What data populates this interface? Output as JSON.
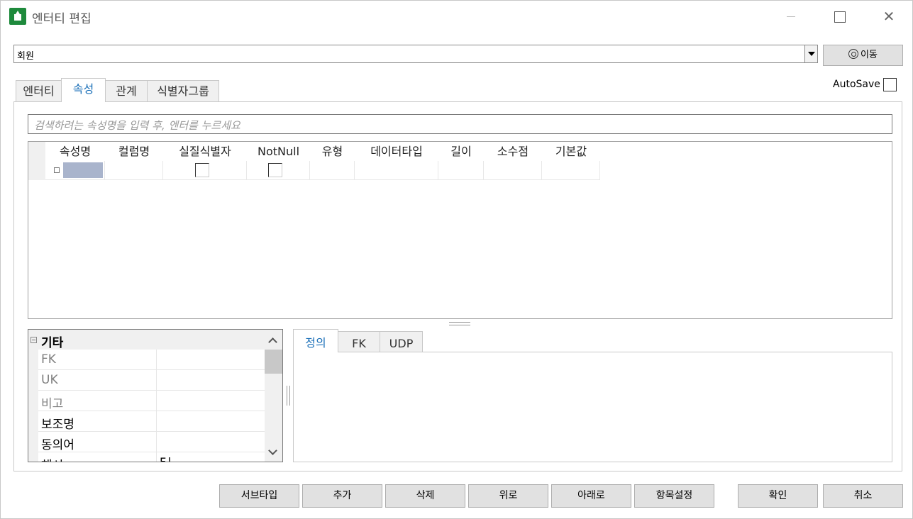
{
  "window": {
    "title": "엔터티 편집",
    "controls": {
      "minimize": "—",
      "maximize": "□",
      "close": "✕"
    }
  },
  "entity_selector": {
    "value": "회원"
  },
  "move_button": {
    "label": "이동",
    "icon": "target-icon"
  },
  "tabs": [
    {
      "label": "엔터티",
      "active": false
    },
    {
      "label": "속성",
      "active": true
    },
    {
      "label": "관계",
      "active": false
    },
    {
      "label": "식별자그룹",
      "active": false
    }
  ],
  "autosave": {
    "label": "AutoSave",
    "checked": false
  },
  "search": {
    "placeholder": "검색하려는 속성명을 입력 후, 엔터를 누르세요",
    "value": ""
  },
  "attribute_grid": {
    "columns": [
      "속성명",
      "컬럼명",
      "실질식별자",
      "NotNull",
      "유형",
      "데이터타입",
      "길이",
      "소수점",
      "기본값"
    ],
    "rows": [
      {
        "name": "",
        "column": "",
        "real_identifier": false,
        "not_null": false,
        "type": "",
        "data_type": "",
        "length": "",
        "decimal": "",
        "default": ""
      }
    ]
  },
  "properties": {
    "category": "기타",
    "collapse_glyph": "⊟",
    "rows": [
      {
        "name": "FK",
        "value": "",
        "greyed": true
      },
      {
        "name": "UK",
        "value": "",
        "greyed": true
      },
      {
        "name": "비고",
        "value": "",
        "greyed": true
      },
      {
        "name": "보조명",
        "value": "",
        "greyed": false
      },
      {
        "name": "동의어",
        "value": "",
        "greyed": false
      },
      {
        "name": "해시",
        "value": "F.l",
        "greyed": false
      }
    ]
  },
  "detail_tabs": [
    {
      "label": "정의",
      "active": true
    },
    {
      "label": "FK",
      "active": false
    },
    {
      "label": "UDP",
      "active": false
    }
  ],
  "buttons": {
    "subtype": "서브타입",
    "add": "추가",
    "delete": "삭제",
    "up": "위로",
    "down": "아래로",
    "item_settings": "항목설정",
    "ok": "확인",
    "cancel": "취소"
  },
  "colors": {
    "active_tab_text": "#1a6fb8",
    "selected_cell": "#a9b4cc",
    "app_icon": "#1e8a3c"
  }
}
